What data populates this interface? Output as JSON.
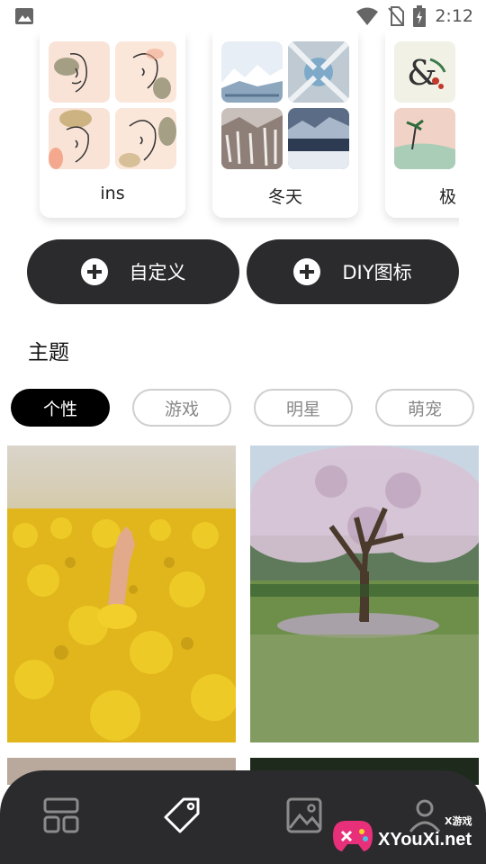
{
  "status_bar": {
    "time": "2:12"
  },
  "icon_packs": [
    {
      "label": "ins"
    },
    {
      "label": "冬天"
    },
    {
      "label": "极"
    }
  ],
  "actions": {
    "custom_label": "自定义",
    "diy_label": "DIY图标"
  },
  "section": {
    "title": "主题"
  },
  "categories": [
    {
      "label": "个性",
      "active": true
    },
    {
      "label": "游戏",
      "active": false
    },
    {
      "label": "明星",
      "active": false
    },
    {
      "label": "萌宠",
      "active": false
    }
  ],
  "bottom_nav": [
    {
      "icon": "layout-grid-icon"
    },
    {
      "icon": "tag-icon"
    },
    {
      "icon": "image-icon"
    },
    {
      "icon": "person-icon"
    }
  ],
  "watermark": {
    "text": "XYouXi.net",
    "small": "X游戏"
  },
  "colors": {
    "dark": "#2b2b2d",
    "chip_border": "#cfcfcf",
    "chip_text": "#888888"
  }
}
